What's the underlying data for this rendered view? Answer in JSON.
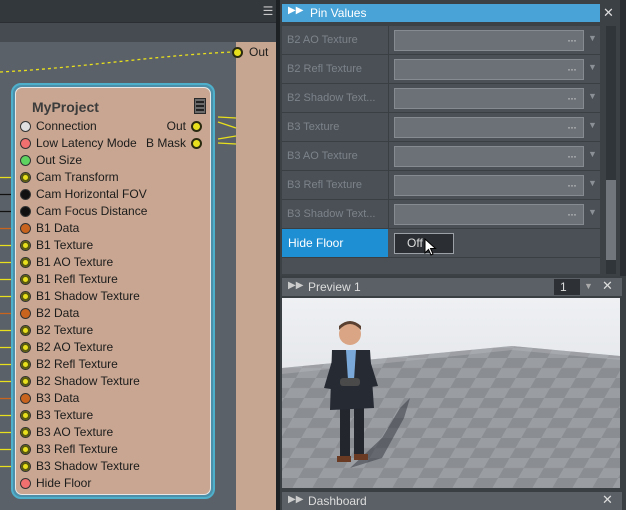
{
  "graph": {
    "out_label": "Out",
    "node": {
      "title": "MyProject",
      "input_pins": [
        {
          "label": "Connection",
          "color": "#e0e0e0"
        },
        {
          "label": "Low Latency Mode",
          "color": "#f07070"
        },
        {
          "label": "Out Size",
          "color": "#5fd35f"
        },
        {
          "label": "Cam Transform",
          "color": "#e8e01c"
        },
        {
          "label": "Cam Horizontal FOV",
          "color": "#111111"
        },
        {
          "label": "Cam Focus Distance",
          "color": "#111111"
        },
        {
          "label": "B1 Data",
          "color": "#c8641e"
        },
        {
          "label": "B1 Texture",
          "color": "#e8e01c"
        },
        {
          "label": "B1 AO Texture",
          "color": "#e8e01c"
        },
        {
          "label": "B1 Refl Texture",
          "color": "#e8e01c"
        },
        {
          "label": "B1 Shadow Texture",
          "color": "#e8e01c"
        },
        {
          "label": "B2 Data",
          "color": "#c8641e"
        },
        {
          "label": "B2 Texture",
          "color": "#e8e01c"
        },
        {
          "label": "B2 AO Texture",
          "color": "#e8e01c"
        },
        {
          "label": "B2 Refl Texture",
          "color": "#e8e01c"
        },
        {
          "label": "B2 Shadow Texture",
          "color": "#e8e01c"
        },
        {
          "label": "B3 Data",
          "color": "#c8641e"
        },
        {
          "label": "B3 Texture",
          "color": "#e8e01c"
        },
        {
          "label": "B3 AO Texture",
          "color": "#e8e01c"
        },
        {
          "label": "B3 Refl Texture",
          "color": "#e8e01c"
        },
        {
          "label": "B3 Shadow Texture",
          "color": "#e8e01c"
        },
        {
          "label": "Hide Floor",
          "color": "#f07070"
        }
      ],
      "output_pins": [
        {
          "label": "Out"
        },
        {
          "label": "B Mask"
        }
      ]
    }
  },
  "pin_values": {
    "title": "Pin Values",
    "rows": [
      {
        "label": "B2 AO Texture"
      },
      {
        "label": "B2 Refl Texture"
      },
      {
        "label": "B2 Shadow Text..."
      },
      {
        "label": "B3 Texture"
      },
      {
        "label": "B3 AO Texture"
      },
      {
        "label": "B3 Refl Texture"
      },
      {
        "label": "B3 Shadow Text..."
      }
    ],
    "browse_glyph": "···",
    "hide_floor": {
      "label": "Hide Floor",
      "value": "Off"
    }
  },
  "preview": {
    "title": "Preview 1",
    "index": "1"
  },
  "dashboard": {
    "title": "Dashboard"
  },
  "colors": {
    "accent": "#1f8fd4",
    "node_body": "#c8a691",
    "node_border": "#4fb0cc"
  }
}
